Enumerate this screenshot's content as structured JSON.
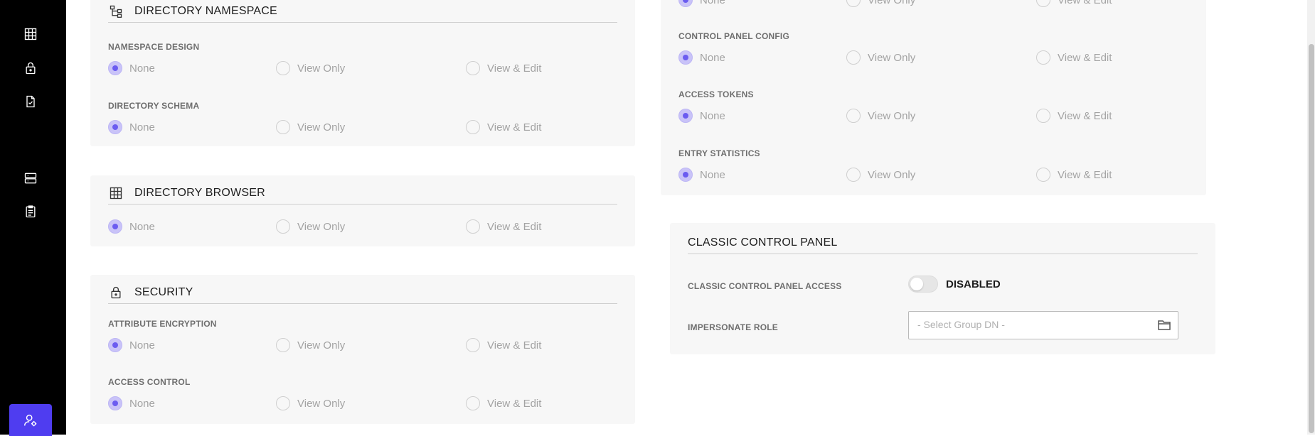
{
  "sidebar": {
    "items": [
      {
        "icon": "table-icon"
      },
      {
        "icon": "lock-icon"
      },
      {
        "icon": "file-check-icon"
      },
      {
        "icon": "server-icon"
      },
      {
        "icon": "clipboard-icon"
      }
    ],
    "active_icon": "user-settings-icon",
    "active_color": "#4f3df0"
  },
  "options": {
    "none": "None",
    "view_only": "View Only",
    "view_edit": "View & Edit"
  },
  "namespace_card": {
    "title": "DIRECTORY NAMESPACE",
    "fields": [
      {
        "label": "NAMESPACE DESIGN",
        "selected": "None"
      },
      {
        "label": "DIRECTORY SCHEMA",
        "selected": "None"
      }
    ]
  },
  "browser_card": {
    "title": "DIRECTORY BROWSER",
    "selected": "None"
  },
  "security_card": {
    "title": "SECURITY",
    "fields": [
      {
        "label": "ATTRIBUTE ENCRYPTION",
        "selected": "None"
      },
      {
        "label": "ACCESS CONTROL",
        "selected": "None"
      }
    ]
  },
  "right_card": {
    "fields": [
      {
        "label": "",
        "selected": "None"
      },
      {
        "label": "CONTROL PANEL CONFIG",
        "selected": "None"
      },
      {
        "label": "ACCESS TOKENS",
        "selected": "None"
      },
      {
        "label": "ENTRY STATISTICS",
        "selected": "None"
      }
    ]
  },
  "classic_card": {
    "title": "CLASSIC CONTROL PANEL",
    "access_label": "CLASSIC CONTROL PANEL ACCESS",
    "toggle_state": "DISABLED",
    "impersonate_label": "IMPERSONATE ROLE",
    "select_placeholder": "- Select Group DN -"
  },
  "colors": {
    "radio_checked": "#6b5cf0",
    "card_bg": "#f7f7f7"
  }
}
